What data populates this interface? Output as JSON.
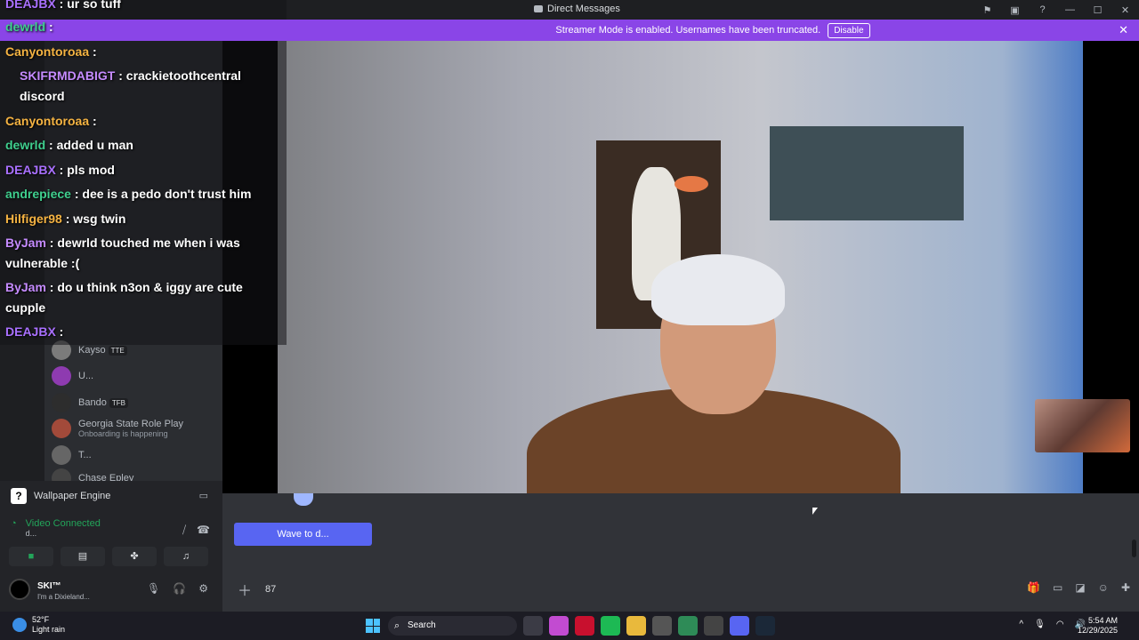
{
  "titlebar": {
    "title": "Direct Messages"
  },
  "streamer": {
    "message": "Streamer Mode is enabled. Usernames have been truncated.",
    "button": "Disable"
  },
  "sidebar": {
    "items": [
      {
        "name": "Kayso",
        "tag": "TTE",
        "sub": ""
      },
      {
        "name": "U...",
        "tag": "",
        "sub": ""
      },
      {
        "name": "Bando",
        "tag": "TFB",
        "sub": ""
      },
      {
        "name": "Georgia State Role Play",
        "tag": "",
        "sub": "Onboarding is happening"
      },
      {
        "name": "T...",
        "tag": "",
        "sub": ""
      },
      {
        "name": "Chase Epley",
        "tag": "",
        "sub": ""
      }
    ]
  },
  "panel": {
    "app": "Wallpaper Engine",
    "voice_status": "Video Connected",
    "voice_channel": "d...",
    "username": "SKI™",
    "user_status": "I'm a Dixieland..."
  },
  "chat_overlay": {
    "messages": [
      {
        "user": "DEAJBX",
        "text": "ur so tuff",
        "color": "#a970ff"
      },
      {
        "user": "dewrld",
        "text": "",
        "color": "#3fcf8e"
      },
      {
        "user": "Canyontoroaa",
        "text": "",
        "color": "#f5b342"
      },
      {
        "user": "SKIFRMDABIGT",
        "text": "crackietoothcentral discord",
        "color": "#c58bff"
      },
      {
        "user": "Canyontoroaa",
        "text": "",
        "color": "#f5b342"
      },
      {
        "user": "dewrld",
        "text": "added u man",
        "color": "#3fcf8e"
      },
      {
        "user": "DEAJBX",
        "text": "pls mod",
        "color": "#a970ff"
      },
      {
        "user": "andrepiece",
        "text": "dee is a pedo don't trust him",
        "color": "#3fcf8e"
      },
      {
        "user": "Hilfiger98",
        "text": "wsg twin",
        "color": "#f5b342"
      },
      {
        "user": "ByJam",
        "text": "dewrld touched me when i was vulnerable :(",
        "color": "#c58bff"
      },
      {
        "user": "ByJam",
        "text": "do u think n3on & iggy are cute cupple",
        "color": "#c58bff"
      },
      {
        "user": "DEAJBX",
        "text": "",
        "color": "#a970ff"
      }
    ]
  },
  "main": {
    "wave_button": "Wave to d...",
    "composer_text": "87"
  },
  "taskbar": {
    "temp": "52°F",
    "weather": "Light rain",
    "search": "Search",
    "time": "5:54 AM",
    "date": "12/29/2025"
  }
}
